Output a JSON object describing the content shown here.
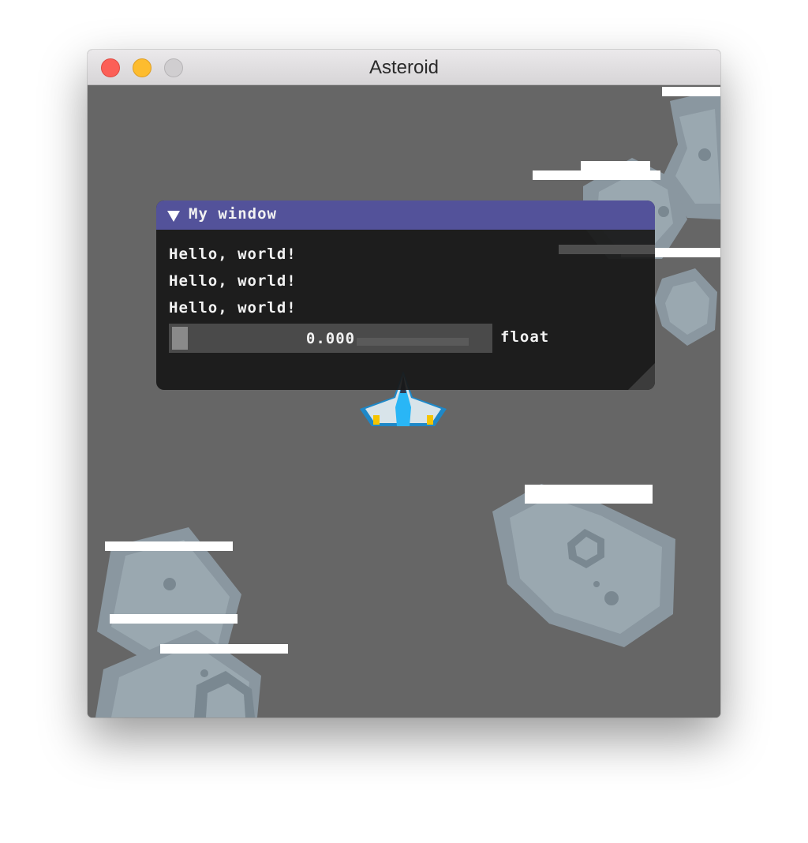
{
  "window": {
    "title": "Asteroid"
  },
  "imgui_window": {
    "title": "My window",
    "lines": [
      "Hello, world!",
      "Hello, world!",
      "Hello, world!"
    ],
    "slider": {
      "value_text": "0.000",
      "label": "float"
    }
  },
  "colors": {
    "game_background": "#666666",
    "imgui_title_bar": "#53529a",
    "imgui_body": "#181818",
    "asteroid_light": "#9aa8b0",
    "asteroid_mid": "#8a97a0",
    "asteroid_dark": "#78858e",
    "ship_blue": "#29b6f6",
    "ship_white": "#d8e4ea"
  }
}
